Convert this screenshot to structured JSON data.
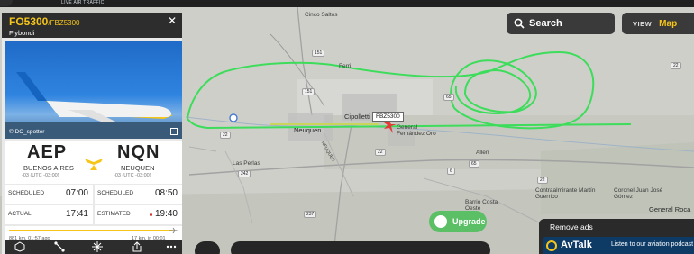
{
  "topbar": {
    "tagline": "LIVE AIR TRAFFIC"
  },
  "search": {
    "label": "Search"
  },
  "view": {
    "label": "VIEW",
    "value": "Map"
  },
  "flight": {
    "id": "FO5300",
    "alt_id": "/FBZ5300",
    "airline": "Flybondi",
    "photo_credit": "© DC_spotter",
    "origin": {
      "code": "AEP",
      "city": "BUENOS AIRES",
      "tz": "-03 (UTC -03:00)"
    },
    "destination": {
      "code": "NQN",
      "city": "NEUQUEN",
      "tz": "-03 (UTC -03:00)"
    },
    "times": {
      "scheduled_dep_label": "SCHEDULED",
      "scheduled_dep": "07:00",
      "scheduled_arr_label": "SCHEDULED",
      "scheduled_arr": "08:50",
      "actual_label": "ACTUAL",
      "actual": "17:41",
      "estimated_label": "ESTIMATED",
      "estimated": "19:40"
    },
    "progress": {
      "fraction": 0.97,
      "left_info": "881 km, 01:57 ago",
      "right_info": "17 km, in 00:01"
    }
  },
  "map": {
    "callsign_tag": "FBZ5300",
    "labels": [
      {
        "name": "Cinco Saltos",
        "kind": "place"
      },
      {
        "name": "Ferri",
        "kind": "place"
      },
      {
        "name": "Neuquen",
        "kind": "city"
      },
      {
        "name": "Cipolletti",
        "kind": "city"
      },
      {
        "name": "General Fernández Oro",
        "kind": "place"
      },
      {
        "name": "NEUQUEN",
        "kind": "road"
      },
      {
        "name": "Las Perlas",
        "kind": "place"
      },
      {
        "name": "Allen",
        "kind": "place"
      },
      {
        "name": "Barrio Costa Oeste",
        "kind": "place"
      },
      {
        "name": "Contraalmirante Martín Guerrico",
        "kind": "place"
      },
      {
        "name": "Coronel Juan José Gómez",
        "kind": "place"
      },
      {
        "name": "General Roca",
        "kind": "city"
      }
    ],
    "route_numbers": [
      "151",
      "151",
      "22",
      "22",
      "65",
      "65",
      "242",
      "237",
      "6",
      "22",
      "22"
    ]
  },
  "upgrade": {
    "label": "Upgrade"
  },
  "ads": {
    "remove_label": "Remove ads",
    "brand": "AvTalk",
    "promo": "Listen to our aviation podcast"
  },
  "icons": {
    "search": "search-icon",
    "close": "close-icon",
    "expand": "expand-icon",
    "plane": "plane-icon",
    "upgrade": "upgrade-icon",
    "location": "location-pin-icon"
  },
  "colors": {
    "accent": "#f5c518",
    "track": "#3ddc5a",
    "panel_dark": "#2d2d2d",
    "upgrade": "#5bbf65"
  }
}
